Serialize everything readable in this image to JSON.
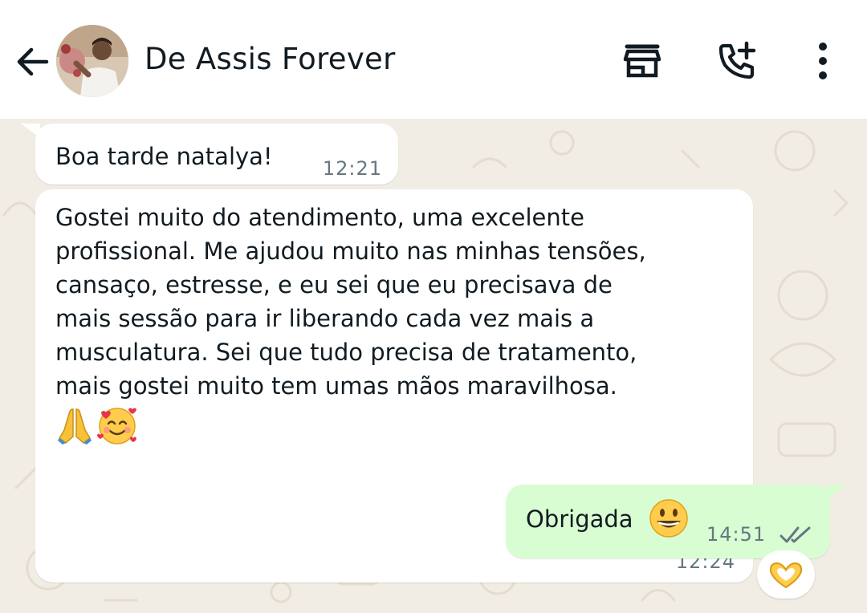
{
  "header": {
    "contact_name": "De Assis Forever",
    "back_icon": "arrow-left-icon",
    "store_icon": "storefront-icon",
    "call_icon": "add-call-icon",
    "menu_icon": "more-vertical-icon"
  },
  "messages": [
    {
      "direction": "incoming",
      "text": "Boa tarde natalya!",
      "time": "12:21"
    },
    {
      "direction": "incoming",
      "lines": [
        "Gostei muito do atendimento, uma excelente",
        "profissional. Me ajudou muito nas minhas tensões,",
        "cansaço, estresse, e eu sei que eu precisava de",
        "mais sessão para ir liberando cada vez mais a",
        "musculatura. Sei que tudo precisa de tratamento,",
        "mais gostei muito tem umas mãos maravilhosa."
      ],
      "emojis": [
        "folded-hands-emoji",
        "smiling-face-with-hearts-emoji"
      ],
      "time": "12:24"
    },
    {
      "direction": "outgoing",
      "text": "Obrigada",
      "emoji": "grinning-face-emoji",
      "time": "14:51",
      "status": "read-double-check-icon",
      "reaction": "heart-hands-emoji"
    }
  ],
  "colors": {
    "header_bg": "#ffffff",
    "chat_bg": "#f1ede4",
    "incoming_bubble": "#ffffff",
    "outgoing_bubble": "#d9fdd3",
    "text": "#111b21",
    "time_text": "#667781"
  }
}
